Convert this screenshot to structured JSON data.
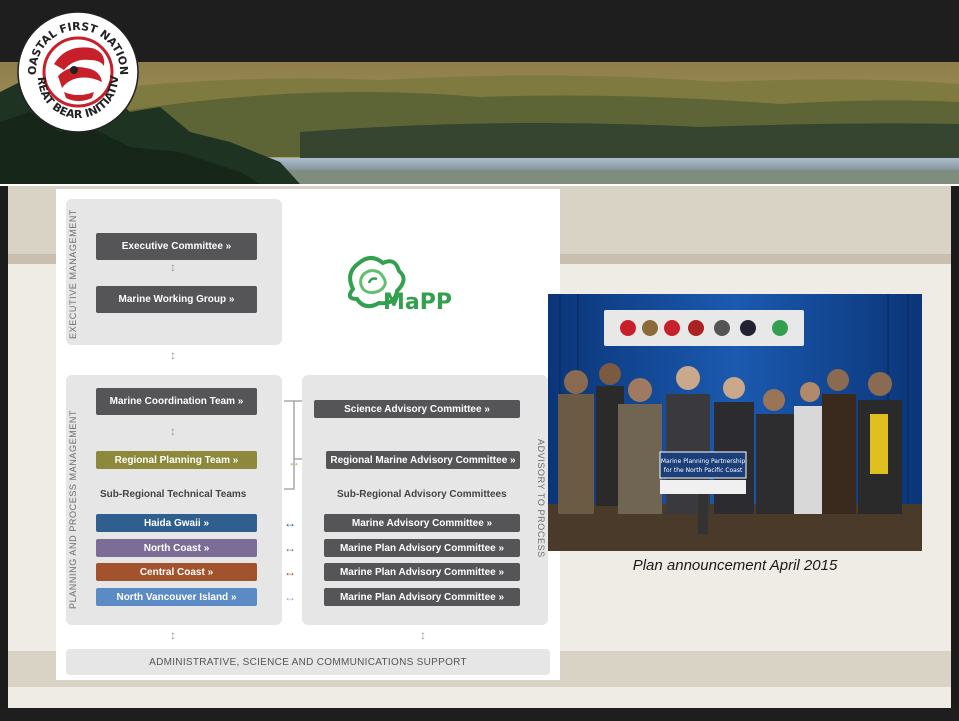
{
  "logo": {
    "text_top": "COASTAL FIRST NATIONS",
    "text_bottom": "GREAT BEAR INITIATIVE"
  },
  "diagram": {
    "executive_label": "Executive Management",
    "planning_label": "Planning and Process Management",
    "advisory_label": "Advisory to Process",
    "executive_committee": "Executive Committee »",
    "marine_working_group": "Marine Working Group »",
    "mapp_logo": "MaPP",
    "marine_coordination_team": "Marine Coordination Team »",
    "regional_planning_team": "Regional Planning Team »",
    "sub_regional_technical_teams": "Sub-Regional Technical Teams",
    "technical_teams": [
      "Haida Gwaii »",
      "North Coast »",
      "Central Coast »",
      "North Vancouver Island »"
    ],
    "science_advisory_committee": "Science Advisory Committee »",
    "regional_marine_advisory_committee": "Regional Marine Advisory Committee »",
    "sub_regional_advisory_committees": "Sub-Regional Advisory Committees",
    "advisory_committees": [
      "Marine Advisory Committee »",
      "Marine Plan Advisory Committee »",
      "Marine Plan Advisory Committee »",
      "Marine Plan Advisory Committee »"
    ],
    "footer": "Administrative, Science and Communications Support"
  },
  "photo": {
    "sign_line1": "Marine Planning Partnership",
    "sign_line2": "for the North Pacific Coast"
  },
  "caption": "Plan announcement April 2015",
  "colors": {
    "dark_box": "#555558",
    "regional_planning": "#8c8a3a",
    "haida_gwaii": "#2f5f8f",
    "north_coast": "#7c6d96",
    "central_coast": "#a2522d",
    "north_vancouver_island": "#5b8bc4"
  }
}
